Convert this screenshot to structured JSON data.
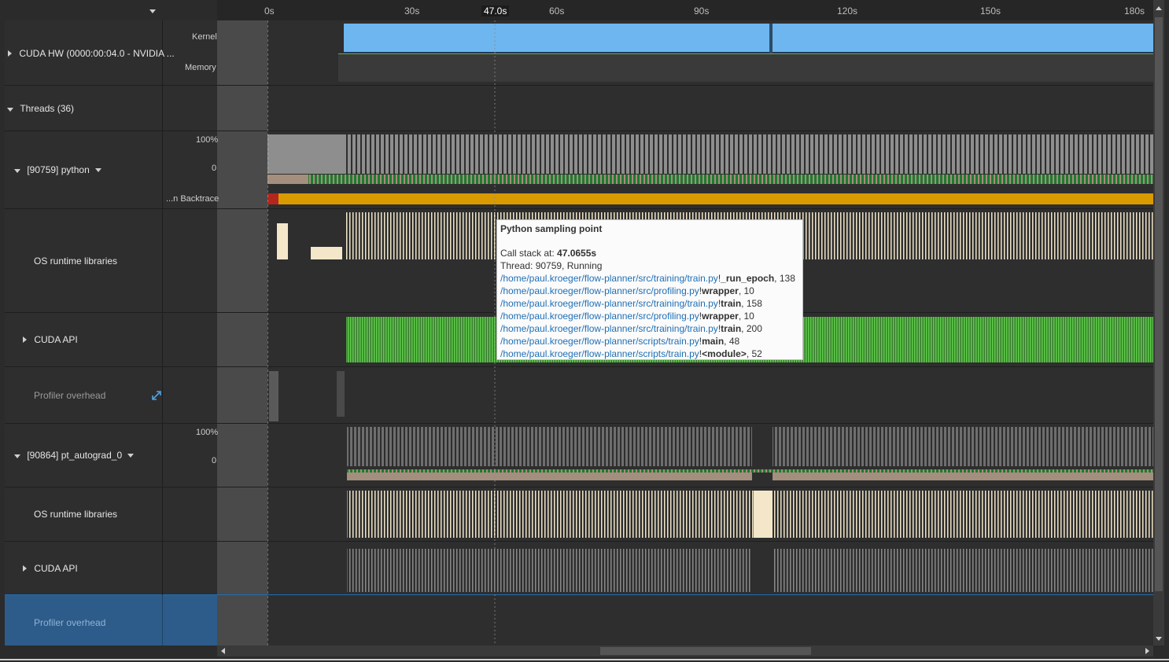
{
  "ruler": {
    "cursor_label": "47.0s",
    "ticks": [
      "0s",
      "30s",
      "60s",
      "90s",
      "120s",
      "150s",
      "180s"
    ]
  },
  "rows": {
    "cuda_hw": {
      "label": "CUDA HW (0000:00:04.0 - NVIDIA ...",
      "kernel": "Kernel",
      "memory": "Memory"
    },
    "threads": {
      "label": "Threads (36)"
    },
    "python": {
      "label": "[90759] python",
      "pct100": "100%",
      "pct0": "0",
      "backtrace": "...n Backtrace"
    },
    "os_runtime_1": {
      "label": "OS runtime libraries"
    },
    "cuda_api_1": {
      "label": "CUDA API"
    },
    "profiler_1": {
      "label": "Profiler overhead"
    },
    "autograd": {
      "label": "[90864] pt_autograd_0",
      "pct100": "100%",
      "pct0": "0"
    },
    "os_runtime_2": {
      "label": "OS runtime libraries"
    },
    "cuda_api_2": {
      "label": "CUDA API"
    },
    "profiler_2": {
      "label": "Profiler overhead"
    }
  },
  "tooltip": {
    "title": "Python sampling point",
    "call_stack_prefix": "Call stack at: ",
    "call_stack_time": "47.0655s",
    "thread": "Thread: 90759, Running",
    "frames": [
      {
        "path": "/home/paul.kroeger/flow-planner/src/training/train.py",
        "func": "_run_epoch",
        "line": ", 138"
      },
      {
        "path": "/home/paul.kroeger/flow-planner/src/profiling.py",
        "func": "wrapper",
        "line": ", 10"
      },
      {
        "path": "/home/paul.kroeger/flow-planner/src/training/train.py",
        "func": "train",
        "line": ", 158"
      },
      {
        "path": "/home/paul.kroeger/flow-planner/src/profiling.py",
        "func": "wrapper",
        "line": ", 10"
      },
      {
        "path": "/home/paul.kroeger/flow-planner/src/training/train.py",
        "func": "train",
        "line": ", 200"
      },
      {
        "path": "/home/paul.kroeger/flow-planner/scripts/train.py",
        "func": "main",
        "line": ", 48"
      },
      {
        "path": "/home/paul.kroeger/flow-planner/scripts/train.py",
        "func": "<module>",
        "line": ", 52"
      }
    ]
  },
  "colors": {
    "kernel": "#6db6ef",
    "cpu_usage": "#8e8e8e",
    "thread_state": "#a48e7e",
    "running": "#1e7a2e",
    "backtrace": "#d99a00",
    "os_runtime": "#f3e6c9",
    "cuda_api": "#5fcf4a",
    "selected_row": "#2d5c8a"
  }
}
